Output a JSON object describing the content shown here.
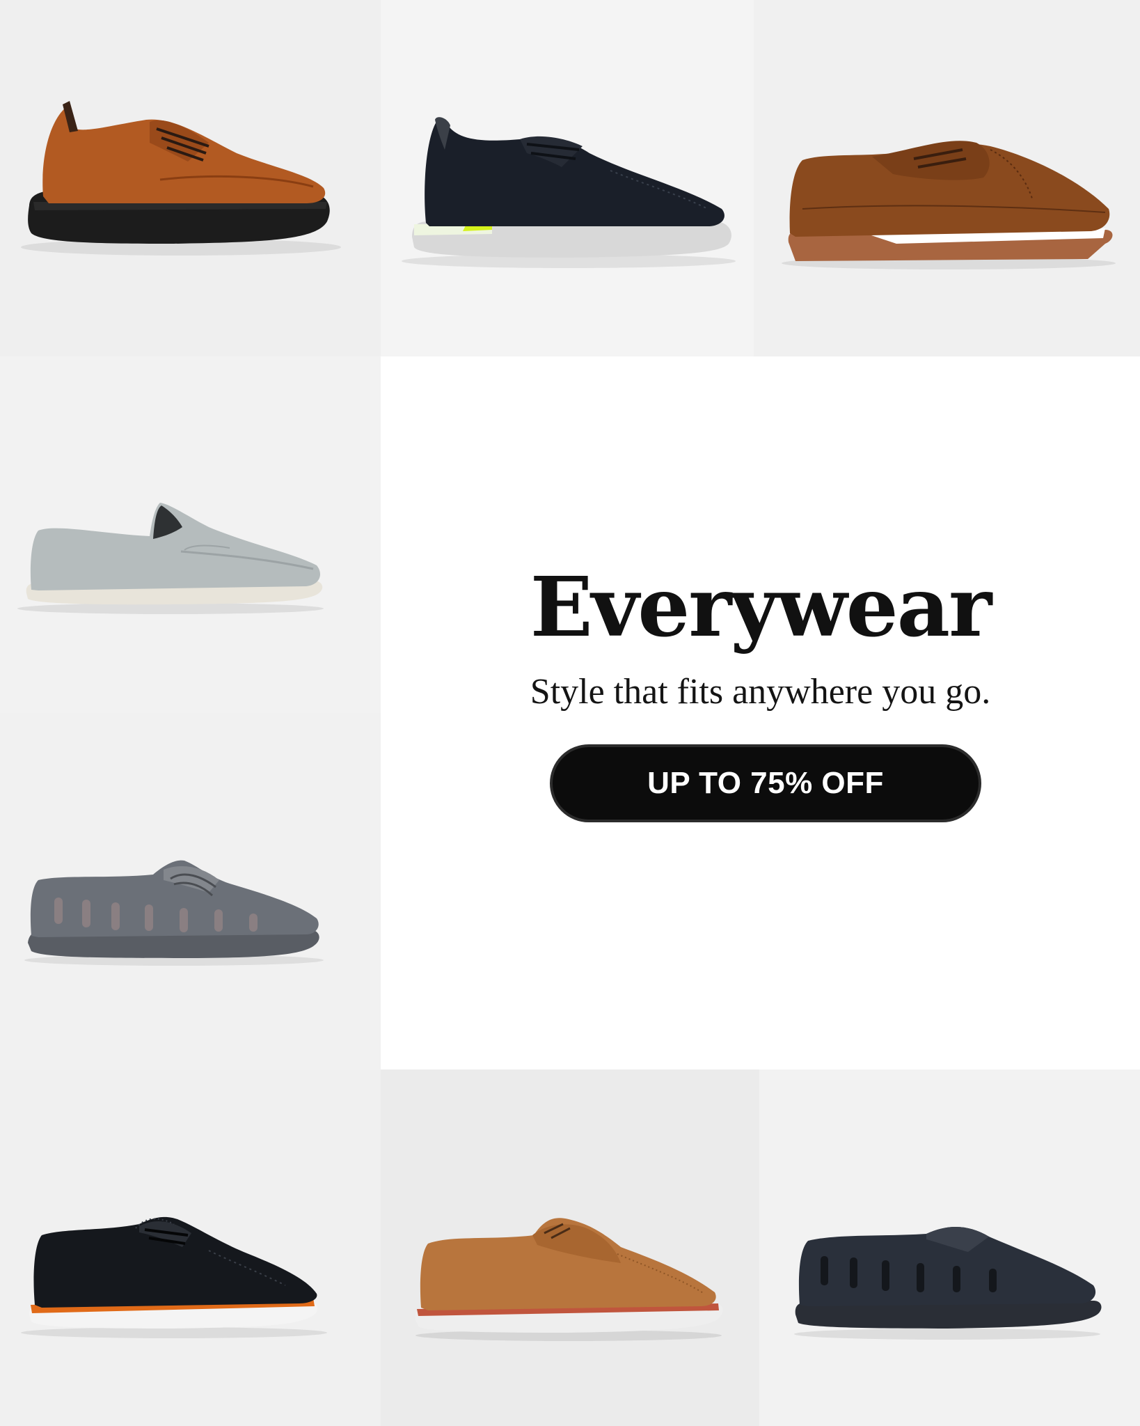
{
  "promo": {
    "headline": "Everywear",
    "subline": "Style that fits anywhere you go.",
    "cta_label": "UP TO 75% OFF"
  },
  "products": [
    {
      "name": "tan-leather-brogue-sneaker-icon",
      "upper": "#b25a22",
      "sole": "#1c1c1c"
    },
    {
      "name": "black-perforated-oxford-sneaker-icon",
      "upper": "#1a1f29",
      "sole": "#d8d8d8",
      "accent": "#d6f21c"
    },
    {
      "name": "brown-leather-oxford-icon",
      "upper": "#8a4a1e",
      "sole": "#a86540"
    },
    {
      "name": "grey-suede-loafer-icon",
      "upper": "#b5bcbd",
      "sole": "#e8e4da"
    },
    {
      "name": "grey-boat-shoe-icon",
      "upper": "#6b7078",
      "sole": "#595d64"
    },
    {
      "name": "black-wingtip-sneaker-icon",
      "upper": "#15181d",
      "sole": "#f4f4f4",
      "accent": "#e06a18"
    },
    {
      "name": "tan-suede-moccasin-icon",
      "upper": "#b8753d",
      "sole": "#eeeeee",
      "accent": "#c0553d"
    },
    {
      "name": "navy-slip-on-loafer-icon",
      "upper": "#2a303b",
      "sole": "#2a2e36"
    }
  ]
}
